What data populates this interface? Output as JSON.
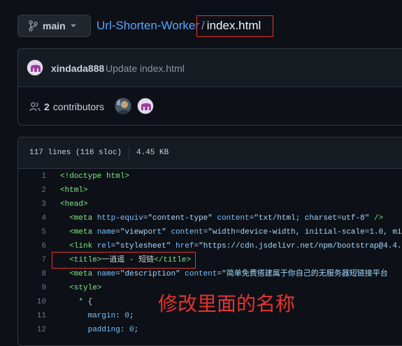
{
  "branch": {
    "label": "main"
  },
  "breadcrumb": {
    "repo": "Url-Shorten-Worker",
    "separator": "/",
    "file": "index.html"
  },
  "commit": {
    "author": "xindada888",
    "message": "Update index.html"
  },
  "contributors": {
    "count": "2",
    "label": "contributors"
  },
  "file_info": {
    "lines": "117 lines (116 sloc)",
    "size": "4.45 KB"
  },
  "code_lines": [
    {
      "n": "1",
      "html": "<span class=\"t\">&lt;!doctype html&gt;</span>"
    },
    {
      "n": "2",
      "html": "<span class=\"t\">&lt;html&gt;</span>"
    },
    {
      "n": "3",
      "html": "<span class=\"t\">&lt;head&gt;</span>"
    },
    {
      "n": "4",
      "html": "  <span class=\"t\">&lt;meta</span> <span class=\"a\">http-equiv</span>=<span class=\"s\">\"content-type\"</span> <span class=\"a\">content</span>=<span class=\"s\">\"txt/html; charset=utf-8\"</span> <span class=\"t\">/&gt;</span>"
    },
    {
      "n": "5",
      "html": "  <span class=\"t\">&lt;meta</span> <span class=\"a\">name</span>=<span class=\"s\">\"viewport\"</span> <span class=\"a\">content</span>=<span class=\"s\">\"width=device-width, initial-scale=1.0, mi</span>"
    },
    {
      "n": "6",
      "html": "  <span class=\"t\">&lt;link</span> <span class=\"a\">rel</span>=<span class=\"s\">\"stylesheet\"</span> <span class=\"a\">href</span>=<span class=\"s\">\"https://cdn.jsdelivr.net/npm/bootstrap@4.4.1</span>"
    },
    {
      "n": "7",
      "html": "  <span class=\"t\">&lt;title&gt;</span><span class=\"p\">一逍遥 - 短链</span><span class=\"t\">&lt;/title&gt;</span>"
    },
    {
      "n": "8",
      "html": "  <span class=\"t\">&lt;meta</span> <span class=\"a\">name</span>=<span class=\"s\">\"description\"</span> <span class=\"a\">content</span>=<span class=\"s\">\"简单免费搭建属于你自己的无服务器短链接平台</span>"
    },
    {
      "n": "9",
      "html": "  <span class=\"t\">&lt;style&gt;</span>"
    },
    {
      "n": "10",
      "html": "    <span class=\"t\">*</span> {"
    },
    {
      "n": "11",
      "html": "      <span class=\"a\">margin</span>: <span class=\"a\">0</span>;"
    },
    {
      "n": "12",
      "html": "      <span class=\"a\">padding</span>: <span class=\"a\">0</span>;"
    }
  ],
  "annotation": "修改里面的名称",
  "colors": {
    "background": "#0d1117",
    "link": "#58a6ff",
    "highlight": "#e5332e",
    "tag": "#7ee787",
    "attr": "#79c0ff",
    "string": "#a5d6ff"
  }
}
